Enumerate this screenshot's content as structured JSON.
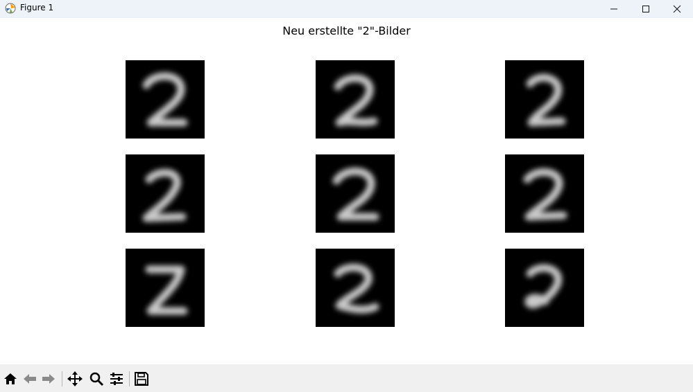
{
  "window": {
    "title": "Figure 1",
    "controls": [
      "minimize-icon",
      "maximize-icon",
      "close-icon"
    ]
  },
  "figure": {
    "title": "Neu erstellte \"2\"-Bilder",
    "grid": {
      "rows": 3,
      "cols": 3
    },
    "images": [
      {
        "label": "2"
      },
      {
        "label": "2"
      },
      {
        "label": "2"
      },
      {
        "label": "2"
      },
      {
        "label": "2"
      },
      {
        "label": "2"
      },
      {
        "label": "2"
      },
      {
        "label": "2"
      },
      {
        "label": "2"
      }
    ]
  },
  "toolbar": {
    "buttons": [
      "home-icon",
      "back-icon",
      "forward-icon",
      "pan-icon",
      "zoom-icon",
      "configure-subplots-icon",
      "save-icon"
    ]
  },
  "colors": {
    "titlebar_bg": "#eef3fa",
    "toolbar_bg": "#f0f0f0",
    "image_bg": "#000000",
    "digit_stroke": "#e0e0e0"
  }
}
